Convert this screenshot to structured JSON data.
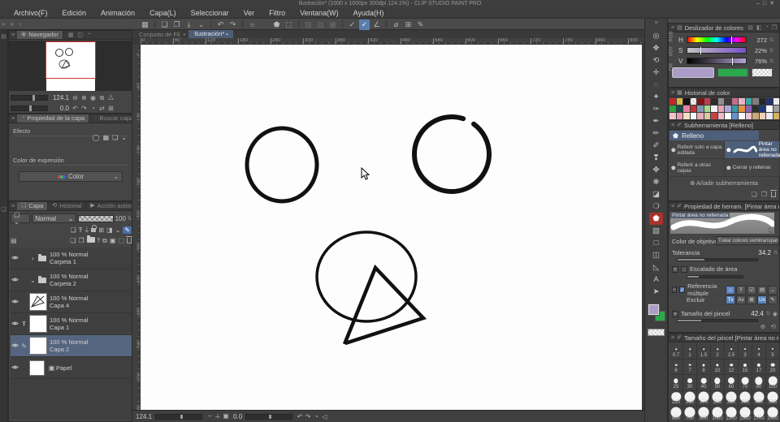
{
  "window": {
    "title": "Ilustración* (1000 x 1000px 300dpi 124.1%) - CLIP STUDIO PAINT PRO",
    "controls": [
      "–",
      "□",
      "✕"
    ]
  },
  "menu": {
    "items": [
      "Archivo(F)",
      "Edición",
      "Animación",
      "Capa(L)",
      "Seleccionar",
      "Ver",
      "Filtro",
      "Ventana(W)",
      "Ayuda(H)"
    ]
  },
  "command_bar": {
    "left_glyphs": "» « ‹",
    "items": [
      {
        "name": "csp-logo-icon",
        "glyph": "▦"
      },
      {
        "name": "sep"
      },
      {
        "name": "new-file-icon",
        "glyph": "❏"
      },
      {
        "name": "open-file-icon",
        "glyph": "❐"
      },
      {
        "name": "save-icon",
        "glyph": "⤓"
      },
      {
        "name": "save-caret-icon",
        "glyph": "⌄"
      },
      {
        "name": "sep"
      },
      {
        "name": "undo-icon",
        "glyph": "↶"
      },
      {
        "name": "redo-icon",
        "glyph": "↷"
      },
      {
        "name": "sep"
      },
      {
        "name": "transform-icon",
        "glyph": "☼"
      },
      {
        "name": "mesh-transform-icon",
        "glyph": "◌",
        "state": "disabled"
      },
      {
        "name": "fill-command-icon",
        "glyph": "⬟"
      },
      {
        "name": "crop-icon",
        "glyph": "⬚"
      },
      {
        "name": "sep"
      },
      {
        "name": "deselect-icon",
        "glyph": "▧",
        "state": "disabled"
      },
      {
        "name": "invert-selection-icon",
        "glyph": "▨",
        "state": "disabled"
      },
      {
        "name": "selection-launcher-icon",
        "glyph": "▩",
        "state": "disabled"
      },
      {
        "name": "sep"
      },
      {
        "name": "snap-ruler-icon",
        "glyph": "✓"
      },
      {
        "name": "snap-special-ruler-icon",
        "glyph": "✓",
        "state": "active"
      },
      {
        "name": "snap-grid-icon",
        "glyph": "∠"
      },
      {
        "name": "sep"
      },
      {
        "name": "rotate-reset-icon",
        "glyph": "⌀"
      },
      {
        "name": "grid-icon",
        "glyph": "⊞"
      },
      {
        "name": "material-icon",
        "glyph": "✎"
      }
    ]
  },
  "document": {
    "workspace_label": "Conjunto de Fil",
    "bullet": "•",
    "tab": "Ilustración*",
    "tab_close": "✕"
  },
  "rulers": {
    "horizontal": [
      0,
      60,
      120,
      180,
      240,
      300,
      360,
      420,
      480,
      540,
      600,
      660,
      720,
      780,
      840,
      900
    ],
    "vertical": [
      0,
      60,
      120,
      180,
      240,
      300,
      360,
      420,
      480,
      540,
      600,
      660
    ]
  },
  "navigator": {
    "tab": "Navegador",
    "header_icons": [
      "▦",
      "◫",
      "◔"
    ],
    "zoom_value": "124.1",
    "zoom_buttons": [
      "⊖",
      "⊕",
      "◉",
      "⧉",
      "⧊"
    ],
    "rotate_value": "0.0",
    "rotate_buttons": [
      "↶",
      "↷",
      "◔",
      "⇄",
      "⊞"
    ]
  },
  "layer_property": {
    "tab": "Propiedad de la capa",
    "tab2": "Buscar capa",
    "effect_label": "Efecto",
    "effect_icons": [
      "◯",
      "▦",
      "❏",
      "⌄"
    ],
    "expression_label": "Color de expresión",
    "expression_value": "Color"
  },
  "layers_panel": {
    "tabs": [
      "Capa",
      "Historial",
      "Acción automática"
    ],
    "blend_mode": "Normal",
    "opacity_value": "100",
    "row1_icons": [
      "❏",
      "Ŧ",
      "⍊",
      "lock",
      "⊞",
      "◨",
      "⌄",
      "✎"
    ],
    "row2_icons": [
      "❏",
      "❐",
      "folder",
      "⤒",
      "⧉",
      "▣",
      "⬚",
      "trash"
    ],
    "layers": [
      {
        "mode": "100 % Normal",
        "name": "Carpeta 1",
        "type": "folder",
        "caret": "›",
        "eye": true,
        "selected": false
      },
      {
        "mode": "100 % Normal",
        "name": "Carpeta 2",
        "type": "folder",
        "caret": "⌄",
        "eye": true,
        "selected": false
      },
      {
        "mode": "100 % Normal",
        "name": "Capa 4",
        "type": "drawing",
        "eye": true,
        "selected": false
      },
      {
        "mode": "100 % Normal",
        "name": "Capa 1",
        "type": "checker",
        "eye": true,
        "badge": "Ŧ",
        "selected": false
      },
      {
        "mode": "100 % Normal",
        "name": "Capa 2",
        "type": "checker",
        "eye": true,
        "badge": "✎",
        "selected": true
      },
      {
        "mode": "",
        "name": "Papel",
        "type": "paper",
        "eye": true,
        "selected": false
      }
    ]
  },
  "toolbar": {
    "tools": [
      {
        "name": "zoom-tool",
        "glyph": "◎"
      },
      {
        "name": "hand-tool",
        "glyph": "✥"
      },
      {
        "name": "rotate-canvas-tool",
        "glyph": "⟲"
      },
      {
        "name": "move-tool",
        "glyph": "✛"
      },
      {
        "name": "selection-tool",
        "glyph": "◌"
      },
      {
        "name": "auto-select-tool",
        "glyph": "✦"
      },
      {
        "name": "eyedropper-tool",
        "glyph": "✑"
      },
      {
        "name": "pen-tool",
        "glyph": "✒"
      },
      {
        "name": "pencil-tool",
        "glyph": "✏"
      },
      {
        "name": "brush-tool",
        "glyph": "✐"
      },
      {
        "name": "watercolor-tool",
        "glyph": "❣"
      },
      {
        "name": "airbrush-tool",
        "glyph": "✤"
      },
      {
        "name": "decoration-tool",
        "glyph": "❋"
      },
      {
        "name": "eraser-tool",
        "glyph": "◪"
      },
      {
        "name": "blend-tool",
        "glyph": "❍"
      },
      {
        "name": "fill-tool",
        "glyph": "⬟",
        "selected": true
      },
      {
        "name": "gradient-tool",
        "glyph": "▧"
      },
      {
        "name": "figure-tool",
        "glyph": "□"
      },
      {
        "name": "frame-border-tool",
        "glyph": "◫"
      },
      {
        "name": "correct-line-tool",
        "glyph": "◺"
      },
      {
        "name": "text-tool",
        "glyph": "A"
      },
      {
        "name": "operation-tool",
        "glyph": "➤"
      }
    ],
    "main_color": "#ab9cc8",
    "sub_color": "#2aa84c"
  },
  "color_slider": {
    "title": "Deslizador de colores",
    "header_icons": [
      "▤",
      "◧",
      "◔",
      "❐"
    ],
    "modes": [
      "RGB",
      "HSV",
      "CM"
    ],
    "rows": [
      {
        "label": "H",
        "value": "272",
        "pct": 75.5
      },
      {
        "label": "S",
        "value": "22%",
        "pct": 22
      },
      {
        "label": "V",
        "value": "76%",
        "pct": 76
      }
    ],
    "main_color": "#ab9cc8",
    "sub_color": "#2aa84c"
  },
  "color_history": {
    "title": "Historial de color",
    "colors": [
      "#c22828",
      "#d9b945",
      "#141414",
      "checker",
      "#7d1616",
      "#c23a4e",
      "#2c2c2c",
      "#8f8f8f",
      "#3a3a3a",
      "#c76d8e",
      "#e9b3c4",
      "#39a8a4",
      "#7f7f7f",
      "#262626",
      "#22356b",
      "#ececec",
      "#2fa342",
      "#174f49",
      "#e283a4",
      "#c23434",
      "#8297ad",
      "#a5da93",
      "#f2f2f2",
      "#e7a2ba",
      "#afa7d8",
      "#3b99a3",
      "#de9342",
      "#8f61b3",
      "#2f2f2f",
      "#1f3a7a",
      "#fafafa",
      "#9e9e9e",
      "#f2c3cb",
      "#e99ab2",
      "#f1e1c3",
      "#fbfbfb",
      "#e9aaba",
      "#d9c9a2",
      "#c74343",
      "#f2bac9",
      "#ffffff",
      "#6a92d2",
      "#f8f8f8",
      "#ecc3d2",
      "#c9a97a",
      "#f1d1b2",
      "#eaeaf2",
      "#d2b262"
    ]
  },
  "subtool": {
    "title": "Subherramienta [Relleno]",
    "group": "Relleno",
    "items": [
      {
        "label": "Referir solo a capa editada",
        "selected": false
      },
      {
        "label": "Pintar área no rellenada",
        "selected": true
      },
      {
        "label": "Referir a otras capas",
        "selected": false
      },
      {
        "label": "Cerrar y rellenar",
        "selected": false
      }
    ],
    "add_label": "Añadir subherramienta",
    "footer_icons": [
      "❏",
      "❐",
      "trash"
    ]
  },
  "tool_property": {
    "title": "Propiedad de herram. [Pintar área no rellenada]",
    "preview_label": "Pintar área no rellenada",
    "target_color_label": "Color de objetivo",
    "target_color_value": "Tratar colores semitransparentes como...",
    "tolerance_label": "Tolerancia",
    "tolerance_value": "34.2",
    "tolerance_pct": 34,
    "area_scaling_label": "Escalado de área",
    "multi_ref_label": "Referencia múltiple",
    "multi_ref_icons": [
      {
        "name": "ref-canvas-icon",
        "glyph": "◇",
        "on": true
      },
      {
        "name": "ref-all-layers-icon",
        "glyph": "Ŧ",
        "on": false
      },
      {
        "name": "ref-selected-icon",
        "glyph": "☑",
        "on": false
      },
      {
        "name": "ref-folder-icon",
        "glyph": "▤",
        "on": false
      },
      {
        "name": "ref-caret-icon",
        "glyph": "⌄",
        "on": false
      }
    ],
    "exclude_label": "Excluir",
    "exclude_icons": [
      {
        "name": "exclude-draft-icon",
        "glyph": "Tx",
        "on": true
      },
      {
        "name": "exclude-text-icon",
        "glyph": "Ax",
        "on": false
      },
      {
        "name": "exclude-editing-icon",
        "glyph": "⊠",
        "on": false
      },
      {
        "name": "exclude-user-icon",
        "glyph": "Ux",
        "on": true
      },
      {
        "name": "exclude-pen-icon",
        "glyph": "✎",
        "on": false
      }
    ],
    "brush_size_label": "Tamaño del pincel",
    "brush_size_value": "42.4",
    "brush_size_pct": 30,
    "footer_icons": [
      "⊕",
      "⟲"
    ]
  },
  "brush_sizes": {
    "title": "Tamaño del pincel [Pintar área no rellenada]",
    "sizes": [
      "0.7",
      "1",
      "1.5",
      "2",
      "2.5",
      "3",
      "4",
      "5",
      "6",
      "7",
      "8",
      "10",
      "12",
      "15",
      "17",
      "20",
      "25",
      "30",
      "40",
      "50",
      "60",
      "70",
      "80",
      "100",
      "120",
      "150",
      "170",
      "200",
      "250",
      "300",
      "400",
      "500",
      "600",
      "700",
      "800",
      "1000",
      "1200",
      "1500",
      "1700",
      "2000"
    ]
  },
  "status_bar": {
    "zoom": "124.1",
    "zoom_buttons": [
      "−",
      "＋",
      "▣"
    ],
    "rotation": "0.0",
    "rotate_buttons": [
      "↶",
      "↷",
      "◔",
      "◁"
    ]
  }
}
